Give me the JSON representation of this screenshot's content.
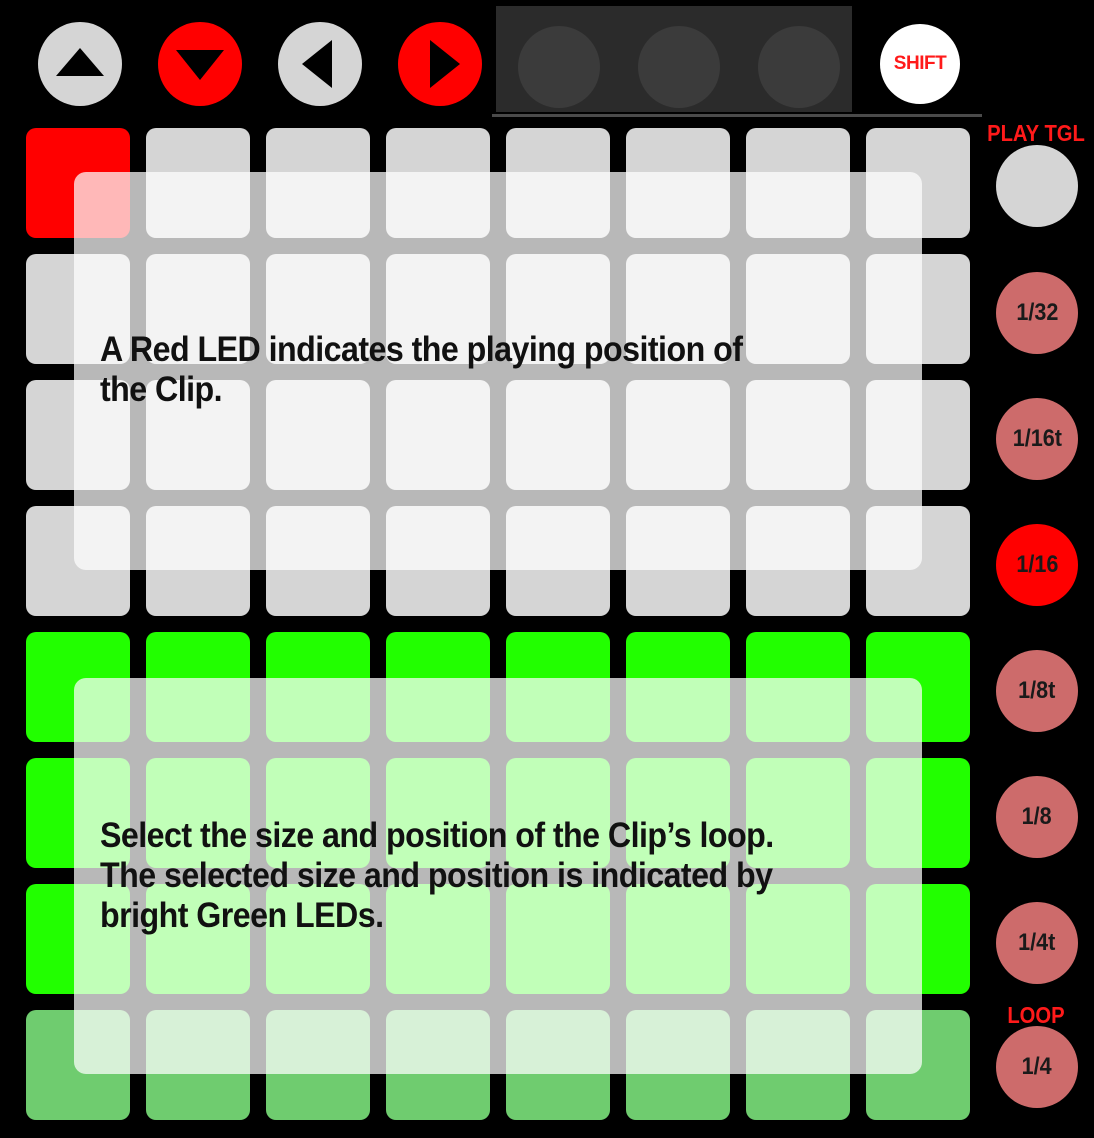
{
  "top_controls": {
    "buttons": [
      {
        "name": "up-arrow-button",
        "icon": "triangle-up-icon",
        "fill": "#d5d5d5",
        "glyph": "#000000"
      },
      {
        "name": "down-arrow-button",
        "icon": "triangle-down-icon",
        "fill": "#ff0000",
        "glyph": "#000000"
      },
      {
        "name": "left-arrow-button",
        "icon": "triangle-left-icon",
        "fill": "#d5d5d5",
        "glyph": "#000000"
      },
      {
        "name": "right-arrow-button",
        "icon": "triangle-right-icon",
        "fill": "#ff0000",
        "glyph": "#000000"
      }
    ],
    "shift_label": "SHIFT"
  },
  "grid": {
    "rows": 8,
    "cols": 8,
    "playing_position": {
      "row": 1,
      "col": 1
    },
    "row_states": [
      "grey",
      "grey",
      "grey",
      "grey",
      "green",
      "green",
      "green",
      "dim-green"
    ],
    "colors": {
      "grey": "#d5d5d5",
      "red": "#ff0000",
      "green": "#22ff00",
      "dim-green": "#6fcc6f"
    }
  },
  "notes": {
    "top": "A Red LED indicates the playing position of\nthe Clip.",
    "bottom": "Select the size and position of the Clip’s loop.\nThe selected size and position is indicated by\nbright Green LEDs."
  },
  "side": {
    "play_tgl_label": "PLAY TGL",
    "loop_label": "LOOP",
    "buttons": [
      {
        "label": "",
        "state": "play"
      },
      {
        "label": "1/32",
        "state": "salmon"
      },
      {
        "label": "1/16t",
        "state": "salmon"
      },
      {
        "label": "1/16",
        "state": "active"
      },
      {
        "label": "1/8t",
        "state": "salmon"
      },
      {
        "label": "1/8",
        "state": "salmon"
      },
      {
        "label": "1/4t",
        "state": "salmon"
      },
      {
        "label": "1/4",
        "state": "salmon"
      }
    ]
  }
}
